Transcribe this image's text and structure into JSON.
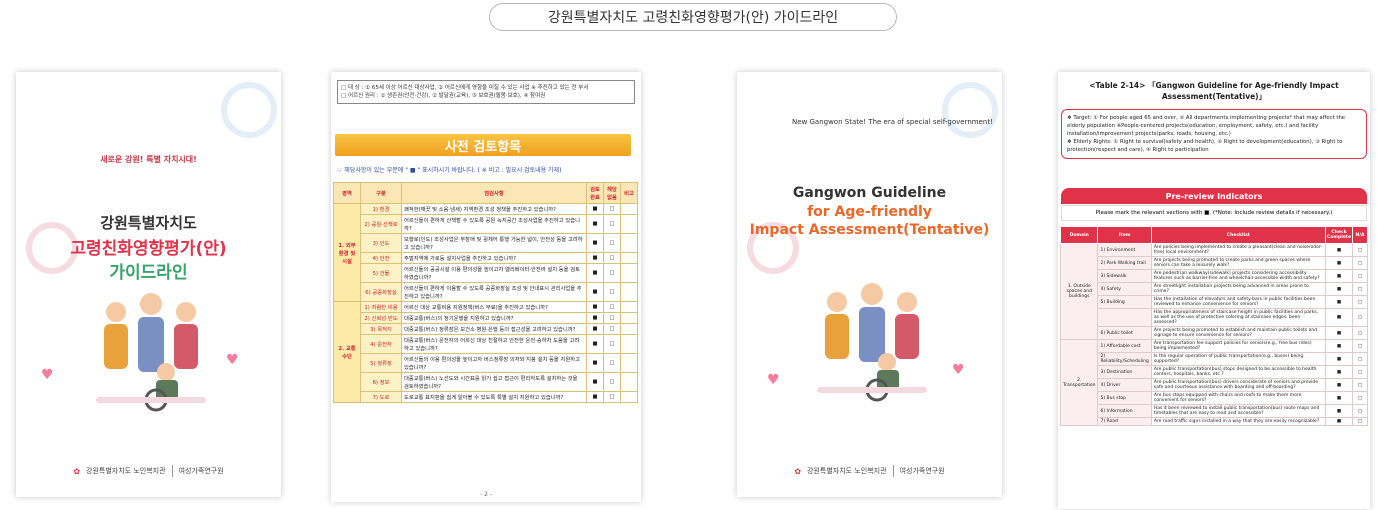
{
  "header_title": "강원특별자치도 고령친화영향평가(안) 가이드라인",
  "cover_kr": {
    "tagline": "새로운 강원! 특별 자치시대!",
    "line1": "강원특별자치도",
    "line2": "고령친화영향평가(안)",
    "line3": "가이드라인",
    "footer_left": "강원특별자치도 노인복지관",
    "footer_right": "여성가족연구원"
  },
  "kr_checklist": {
    "top_lines": [
      "□ 대    상 : ① 65세 이상 어르신 대상사업, ② 어르신에게 영향을 미칠 수 있는 사업 ※ 추진하고 있는 전 부서",
      "□ 어르신 권리 : ① 생존권(안전·건강), ② 발달권(교육), ③ 보호권(돌봄·보호), ④ 참여권"
    ],
    "button": "사전 검토항목",
    "hint": "☞ 해당사항이 있는 부분에 \" ■ \" 표시하시기 바랍니다. ( ※ 비고 : 필요시 검토내용 기재)",
    "headers": [
      "영역",
      "구분",
      "점검사항",
      "검토완료",
      "해당없음",
      "비고"
    ],
    "sections": [
      {
        "cat": "1. 외부환경 및 시설",
        "rows": [
          {
            "sub": "1) 환경",
            "text": "쾌적한(깨끗 및 소음·냄새) 지역환경 조성 정책을 추진하고 있습니까?"
          },
          {
            "sub": "2) 공원·산책로",
            "text": "어르신들이 편하게 산책할 수 있도록 공원 녹지공간 조성사업을 추진하고 있습니까?"
          },
          {
            "sub": "3) 인도",
            "text": "보행로(인도) 조성사업은 무장애 및 휠체어 통행 가능한 넓이, 안전성 등을 고려하고 있습니까?"
          },
          {
            "sub": "4) 안전",
            "text": "주벌지역에 가로등 설치사업을 추진하고 있습니까?"
          },
          {
            "sub": "5) 건물",
            "text": "어르신들의 공공시설 이용 편의성을 높이고자 엘리베이터·안전바 설치 등을 검토하였습니까?"
          },
          {
            "sub": "6) 공중화장실",
            "text": "어르신들이 편하게 이용할 수 있도록 공중화장실 조성 및 안내표시 관리사업을 추진하고 있습니까?"
          }
        ]
      },
      {
        "cat": "2. 교통수단",
        "rows": [
          {
            "sub": "1) 저렴한 비용",
            "text": "어르신 대상 교통비용 지원정책(버스 무료)을 추진하고 있습니까?"
          },
          {
            "sub": "2) 신뢰성·빈도",
            "text": "대중교통(버스)의 정기운행을 지원하고 있습니까?"
          },
          {
            "sub": "3) 목적지",
            "text": "대중교통(버스) 정류장은 보건소·병원·은행 등의 접근성을 고려하고 있습니까?"
          },
          {
            "sub": "4) 운전자",
            "text": "대중교통(버스) 운전자의 어르신 대상 친절하고 안전한 운전·승하차 도움을 고려하고 있습니까?"
          },
          {
            "sub": "5) 정류장",
            "text": "어르신들의 이용 편의성을 높이고자 버스정류장 의자와 지붕 설치 등을 지원하고 있습니까?"
          },
          {
            "sub": "6) 정보",
            "text": "대중교통(버스) 노선도와 시간표를 읽기 쉽고 접근이 편리하도록 설치하는 것을 검토하였습니까?"
          },
          {
            "sub": "7) 도로",
            "text": "도로교통 표지판을 쉽게 알아볼 수 있도록 특별 설치 지원하고 있습니까?"
          }
        ]
      }
    ],
    "page_number": "- 2 -"
  },
  "cover_en": {
    "top_line": "New Gangwon State! The era of special self-government!",
    "line1": "Gangwon Guideline",
    "line2": "for Age-friendly",
    "line3": "Impact Assessment(Tentative)",
    "footer_left": "강원특별자치도 노인복지관",
    "footer_right": "여성가족연구원"
  },
  "en_checklist": {
    "title": "<Table 2-14> 「Gangwon Guideline for Age-friendly Impact Assessment(Tentative)」",
    "target": "❖ Target: ① For people aged 65 and over, ② All departments implementing projects* that may affect the elderly population ※People-centered projects(education, employment, safety, etc.) and facility installation/improvement projects(parks, roads, housing, etc.)",
    "rights": "❖ Elderly Rights: ① Right to survival(safety and health), ② Right to development(education), ③ Right to protection(respect and care), ④ Right to participation",
    "bar": "Pre-review Indicators",
    "note": "Please mark the relevant sections with ■. (*Note: Include review details if necessary.)",
    "headers": [
      "Domain",
      "Item",
      "Checklist",
      "Check Complete",
      "N/A"
    ],
    "sections": [
      {
        "dom": "1. Outside spaces and buildings",
        "rows": [
          {
            "item": "1) Environment",
            "text": "Are policies being implemented to create a pleasant(clean and noise/odor-free) local environment?"
          },
          {
            "item": "2) Park·Walking trail",
            "text": "Are projects being promoted to create parks and green spaces where seniors can take a leisurely walk?"
          },
          {
            "item": "3) Sidewalk",
            "text": "Are pedestrian walkway(sidewalk) projects considering accessibility features such as barrier-free and wheelchair-accessible width and safety?"
          },
          {
            "item": "4) Safety",
            "text": "Are streetlight installation projects being advanced in areas prone to crime?"
          },
          {
            "item": "5) Building",
            "text": "Has the installation of elevators and safety bars in public facilities been reviewed to enhance convenience for seniors?"
          },
          {
            "item": "",
            "text": "Has the appropriateness of staircase height in public facilities and parks, as well as the use of protective coloring at staircase edges, been assessed?"
          },
          {
            "item": "6) Public toilet",
            "text": "Are projects being promoted to establish and maintain public toilets and signage to ensure convenience for seniors?"
          }
        ]
      },
      {
        "dom": "2. Transportation",
        "rows": [
          {
            "item": "1) Affordable cost",
            "text": "Are transportation fee support policies for seniors(e.g., free bus rides) being implemented?"
          },
          {
            "item": "2) Reliability/Scheduling",
            "text": "Is the regular operation of public transportation(e.g., buses) being supported?"
          },
          {
            "item": "3) Destination",
            "text": "Are public transportation(bus) stops designed to be accessible to health centers, hospitals, banks, etc.?"
          },
          {
            "item": "4) Driver",
            "text": "Are public transportation(bus) drivers considerate of seniors and provide safe and courteous assistance with boarding and off-boarding?"
          },
          {
            "item": "5) Bus stop",
            "text": "Are bus stops equipped with chairs and roofs to make them more convenient for seniors?"
          },
          {
            "item": "6) Information",
            "text": "Has it been reviewed to install public transportation(bus) route maps and timetables that are easy to read and accessible?"
          },
          {
            "item": "7) Road",
            "text": "Are road traffic signs installed in a way that they are easily recognizable?"
          }
        ]
      }
    ]
  },
  "colors": {
    "accent_red": "#e0334a",
    "accent_green": "#37a36b",
    "accent_orange": "#e8682a",
    "gold": "#f0a020"
  }
}
